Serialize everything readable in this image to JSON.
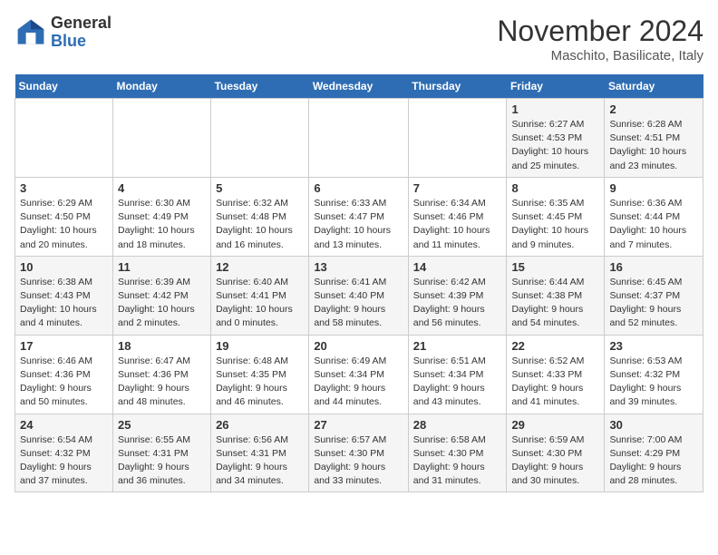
{
  "header": {
    "logo_general": "General",
    "logo_blue": "Blue",
    "month": "November 2024",
    "location": "Maschito, Basilicate, Italy"
  },
  "weekdays": [
    "Sunday",
    "Monday",
    "Tuesday",
    "Wednesday",
    "Thursday",
    "Friday",
    "Saturday"
  ],
  "weeks": [
    [
      {
        "day": "",
        "info": ""
      },
      {
        "day": "",
        "info": ""
      },
      {
        "day": "",
        "info": ""
      },
      {
        "day": "",
        "info": ""
      },
      {
        "day": "",
        "info": ""
      },
      {
        "day": "1",
        "info": "Sunrise: 6:27 AM\nSunset: 4:53 PM\nDaylight: 10 hours and 25 minutes."
      },
      {
        "day": "2",
        "info": "Sunrise: 6:28 AM\nSunset: 4:51 PM\nDaylight: 10 hours and 23 minutes."
      }
    ],
    [
      {
        "day": "3",
        "info": "Sunrise: 6:29 AM\nSunset: 4:50 PM\nDaylight: 10 hours and 20 minutes."
      },
      {
        "day": "4",
        "info": "Sunrise: 6:30 AM\nSunset: 4:49 PM\nDaylight: 10 hours and 18 minutes."
      },
      {
        "day": "5",
        "info": "Sunrise: 6:32 AM\nSunset: 4:48 PM\nDaylight: 10 hours and 16 minutes."
      },
      {
        "day": "6",
        "info": "Sunrise: 6:33 AM\nSunset: 4:47 PM\nDaylight: 10 hours and 13 minutes."
      },
      {
        "day": "7",
        "info": "Sunrise: 6:34 AM\nSunset: 4:46 PM\nDaylight: 10 hours and 11 minutes."
      },
      {
        "day": "8",
        "info": "Sunrise: 6:35 AM\nSunset: 4:45 PM\nDaylight: 10 hours and 9 minutes."
      },
      {
        "day": "9",
        "info": "Sunrise: 6:36 AM\nSunset: 4:44 PM\nDaylight: 10 hours and 7 minutes."
      }
    ],
    [
      {
        "day": "10",
        "info": "Sunrise: 6:38 AM\nSunset: 4:43 PM\nDaylight: 10 hours and 4 minutes."
      },
      {
        "day": "11",
        "info": "Sunrise: 6:39 AM\nSunset: 4:42 PM\nDaylight: 10 hours and 2 minutes."
      },
      {
        "day": "12",
        "info": "Sunrise: 6:40 AM\nSunset: 4:41 PM\nDaylight: 10 hours and 0 minutes."
      },
      {
        "day": "13",
        "info": "Sunrise: 6:41 AM\nSunset: 4:40 PM\nDaylight: 9 hours and 58 minutes."
      },
      {
        "day": "14",
        "info": "Sunrise: 6:42 AM\nSunset: 4:39 PM\nDaylight: 9 hours and 56 minutes."
      },
      {
        "day": "15",
        "info": "Sunrise: 6:44 AM\nSunset: 4:38 PM\nDaylight: 9 hours and 54 minutes."
      },
      {
        "day": "16",
        "info": "Sunrise: 6:45 AM\nSunset: 4:37 PM\nDaylight: 9 hours and 52 minutes."
      }
    ],
    [
      {
        "day": "17",
        "info": "Sunrise: 6:46 AM\nSunset: 4:36 PM\nDaylight: 9 hours and 50 minutes."
      },
      {
        "day": "18",
        "info": "Sunrise: 6:47 AM\nSunset: 4:36 PM\nDaylight: 9 hours and 48 minutes."
      },
      {
        "day": "19",
        "info": "Sunrise: 6:48 AM\nSunset: 4:35 PM\nDaylight: 9 hours and 46 minutes."
      },
      {
        "day": "20",
        "info": "Sunrise: 6:49 AM\nSunset: 4:34 PM\nDaylight: 9 hours and 44 minutes."
      },
      {
        "day": "21",
        "info": "Sunrise: 6:51 AM\nSunset: 4:34 PM\nDaylight: 9 hours and 43 minutes."
      },
      {
        "day": "22",
        "info": "Sunrise: 6:52 AM\nSunset: 4:33 PM\nDaylight: 9 hours and 41 minutes."
      },
      {
        "day": "23",
        "info": "Sunrise: 6:53 AM\nSunset: 4:32 PM\nDaylight: 9 hours and 39 minutes."
      }
    ],
    [
      {
        "day": "24",
        "info": "Sunrise: 6:54 AM\nSunset: 4:32 PM\nDaylight: 9 hours and 37 minutes."
      },
      {
        "day": "25",
        "info": "Sunrise: 6:55 AM\nSunset: 4:31 PM\nDaylight: 9 hours and 36 minutes."
      },
      {
        "day": "26",
        "info": "Sunrise: 6:56 AM\nSunset: 4:31 PM\nDaylight: 9 hours and 34 minutes."
      },
      {
        "day": "27",
        "info": "Sunrise: 6:57 AM\nSunset: 4:30 PM\nDaylight: 9 hours and 33 minutes."
      },
      {
        "day": "28",
        "info": "Sunrise: 6:58 AM\nSunset: 4:30 PM\nDaylight: 9 hours and 31 minutes."
      },
      {
        "day": "29",
        "info": "Sunrise: 6:59 AM\nSunset: 4:30 PM\nDaylight: 9 hours and 30 minutes."
      },
      {
        "day": "30",
        "info": "Sunrise: 7:00 AM\nSunset: 4:29 PM\nDaylight: 9 hours and 28 minutes."
      }
    ]
  ]
}
